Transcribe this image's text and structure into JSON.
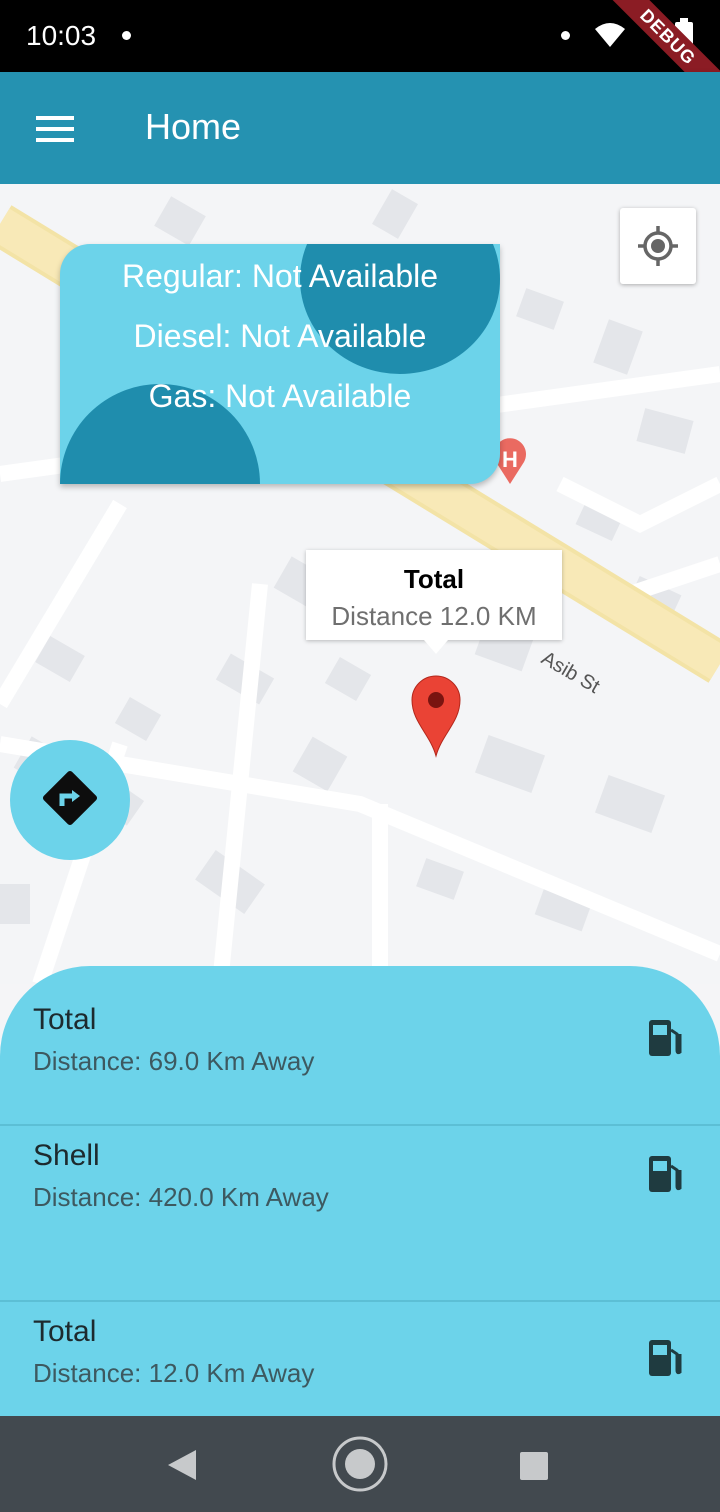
{
  "status_bar": {
    "time": "10:03",
    "debug_label": "DEBUG"
  },
  "app_bar": {
    "title": "Home"
  },
  "map": {
    "street_label": "Asib St",
    "fuel_card": {
      "regular": "Regular: Not Available",
      "diesel": "Diesel: Not Available",
      "gas": "Gas: Not Available"
    },
    "info_window": {
      "title": "Total",
      "snippet": "Distance 12.0 KM"
    },
    "poi_letter": "H"
  },
  "stations": [
    {
      "name": "Total",
      "distance": "Distance: 69.0 Km Away"
    },
    {
      "name": "Shell",
      "distance": "Distance: 420.0 Km Away"
    },
    {
      "name": "Total",
      "distance": "Distance: 12.0 Km Away"
    }
  ],
  "colors": {
    "app_bar": "#2592b1",
    "accent": "#6cd3ea",
    "card_blob": "#1f8dad",
    "marker": "#ea4335"
  }
}
